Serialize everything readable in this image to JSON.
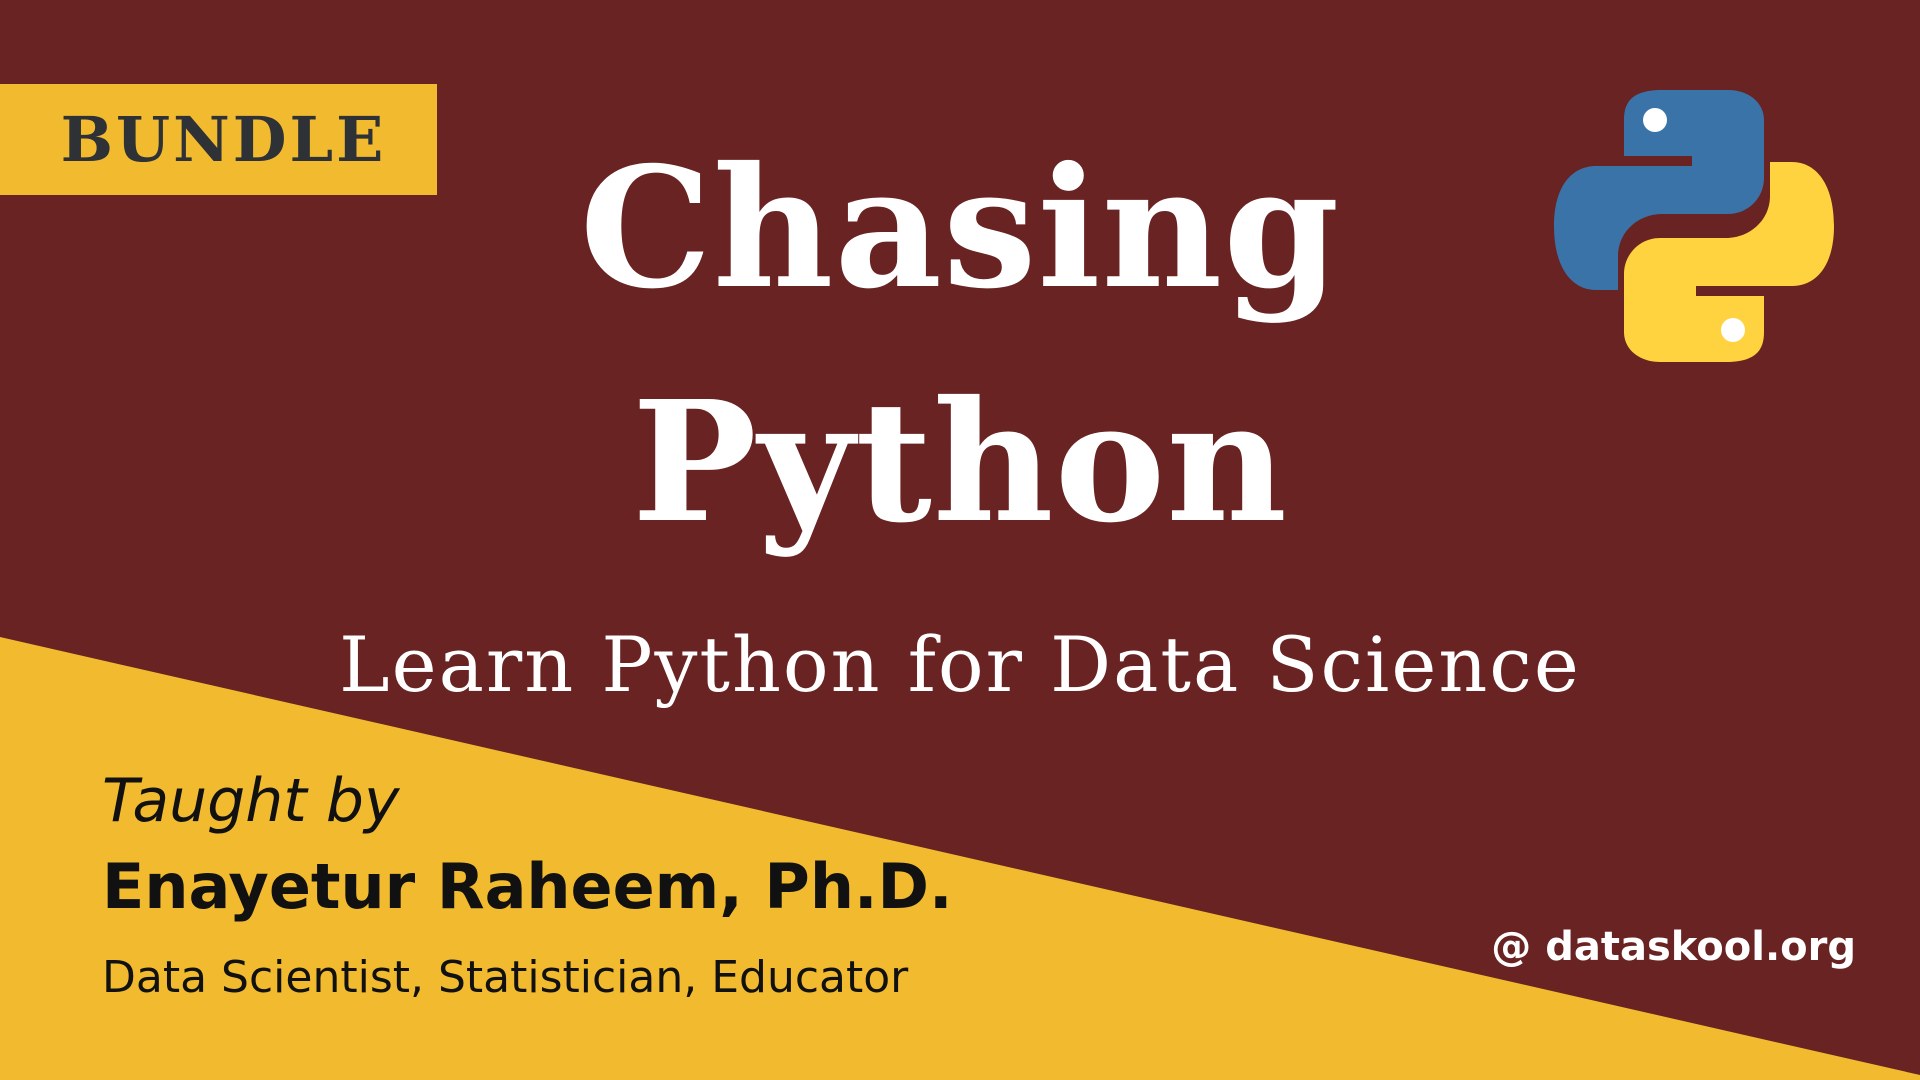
{
  "badge": {
    "label": "BUNDLE"
  },
  "title": {
    "line1": "Chasing",
    "line2": "Python"
  },
  "subtitle": "Learn Python for Data Science",
  "instructor": {
    "intro": "Taught by",
    "name": "Enayetur Raheem, Ph.D.",
    "roles": "Data Scientist, Statistician, Educator"
  },
  "website": "@ dataskool.org",
  "logo": {
    "icon": "python-logo-icon"
  },
  "colors": {
    "background": "#692322",
    "accent_yellow": "#f1ba2f",
    "badge_text": "#2e3136",
    "python_blue": "#3a73a8",
    "python_yellow": "#ffd23f"
  }
}
